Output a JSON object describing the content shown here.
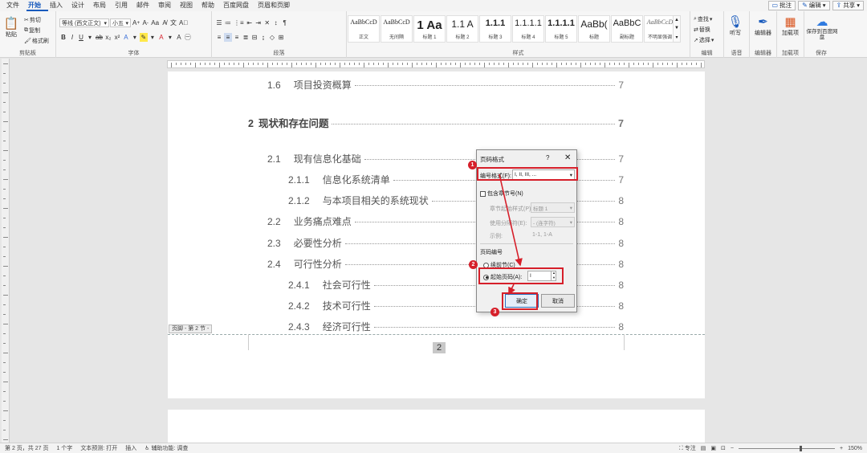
{
  "menubar": {
    "tabs": [
      "文件",
      "开始",
      "插入",
      "设计",
      "布局",
      "引用",
      "邮件",
      "审阅",
      "视图",
      "帮助",
      "百度网盘",
      "页眉和页脚"
    ],
    "active_tab": "开始",
    "right_buttons": [
      "批注",
      "编辑",
      "共享"
    ]
  },
  "ribbon": {
    "clipboard": {
      "paste": "粘贴",
      "cut": "剪切",
      "copy": "复制",
      "format_painter": "格式刷",
      "label": "剪贴板"
    },
    "font": {
      "font_name": "等线 (西文正文)",
      "font_size": "小五",
      "label": "字体"
    },
    "paragraph": {
      "label": "段落"
    },
    "styles": {
      "label": "样式",
      "items": [
        {
          "sample": "AaBbCcD",
          "name": "正文"
        },
        {
          "sample": "AaBbCcD",
          "name": "无间隔"
        },
        {
          "sample": "1 Aa",
          "name": "标题 1"
        },
        {
          "sample": "1.1 A",
          "name": "标题 2"
        },
        {
          "sample": "1.1.1",
          "name": "标题 3"
        },
        {
          "sample": "1.1.1.1",
          "name": "标题 4"
        },
        {
          "sample": "1.1.1.1",
          "name": "标题 5"
        },
        {
          "sample": "AaBb(",
          "name": "标题"
        },
        {
          "sample": "AaBbC",
          "name": "副标题"
        },
        {
          "sample": "AaBbCcD",
          "name": "不明显强调"
        }
      ]
    },
    "editing": {
      "find": "查找",
      "replace": "替换",
      "select": "选择",
      "label": "编辑"
    },
    "voice": {
      "dictate": "听写",
      "label": "语音"
    },
    "editor": {
      "name": "编辑器",
      "label": "编辑器"
    },
    "addins": {
      "name": "加载项",
      "label": "加载项"
    },
    "save": {
      "name": "保存到百度网盘",
      "label": "保存"
    }
  },
  "document": {
    "toc": [
      {
        "num": "1.6",
        "text": "项目投资概算",
        "page": "7",
        "level": 2
      },
      {
        "num": "2",
        "text": "现状和存在问题",
        "page": "7",
        "level": 1
      },
      {
        "num": "2.1",
        "text": "现有信息化基础",
        "page": "7",
        "level": 2
      },
      {
        "num": "2.1.1",
        "text": "信息化系统清单",
        "page": "7",
        "level": 3
      },
      {
        "num": "2.1.2",
        "text": "与本项目相关的系统现状",
        "page": "8",
        "level": 3
      },
      {
        "num": "2.2",
        "text": "业务痛点难点",
        "page": "8",
        "level": 2
      },
      {
        "num": "2.3",
        "text": "必要性分析",
        "page": "8",
        "level": 2
      },
      {
        "num": "2.4",
        "text": "可行性分析",
        "page": "8",
        "level": 2
      },
      {
        "num": "2.4.1",
        "text": "社会可行性",
        "page": "8",
        "level": 3
      },
      {
        "num": "2.4.2",
        "text": "技术可行性",
        "page": "8",
        "level": 3
      },
      {
        "num": "2.4.3",
        "text": "经济可行性",
        "page": "8",
        "level": 3
      }
    ],
    "footer_tag": "页脚 - 第 2 节 -",
    "page_number": "2"
  },
  "dialog": {
    "title": "页码格式",
    "help": "?",
    "close": "✕",
    "number_format_label": "编号格式(F):",
    "number_format_value": "I, II, III, ...",
    "include_chapter_label": "包含章节号(N)",
    "chapter_start_style_label": "章节起始样式(P)",
    "chapter_start_style_value": "标题 1",
    "separator_label": "使用分隔符(E):",
    "separator_value": "- (连字符)",
    "example_label": "示例:",
    "example_value": "1-1, 1-A",
    "page_numbering_label": "页码编号",
    "continue_label": "续前节(C)",
    "start_at_label": "起始页码(A):",
    "start_at_value": "I",
    "ok_label": "确定",
    "cancel_label": "取消"
  },
  "annotations": [
    "1",
    "2",
    "3"
  ],
  "statusbar": {
    "page": "第 2 页，共 27 页",
    "words": "1 个字",
    "predict": "文本预测: 打开",
    "mode": "插入",
    "accessibility": "辅助功能: 调查",
    "focus": "专注",
    "zoom": "150%"
  },
  "colors": {
    "accent": "#185abd",
    "annotation_red": "#d61f2a"
  }
}
